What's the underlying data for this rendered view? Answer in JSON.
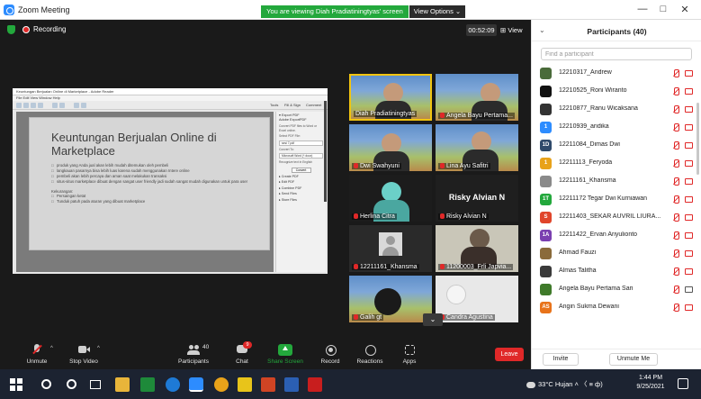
{
  "window": {
    "title": "Zoom Meeting",
    "viewing_banner": "You are viewing Diah Pradiatiningtyas' screen",
    "view_options": "View Options ⌄",
    "minimize": "—",
    "maximize": "□",
    "close": "✕"
  },
  "meeting": {
    "recording_label": "Recording",
    "timer": "00:52:09",
    "view_label": "⊞ View"
  },
  "shared": {
    "viewer_title": "Keuntungan Berjualan Online di Marketplace - Adobe Reader",
    "menu": "File Edit View Window Help",
    "toolbar_right": [
      "Tools",
      "Fill & Sign",
      "Comment"
    ],
    "slide_title": "Keuntungan Berjualan Online di Marketplace",
    "bullets": [
      "produk yang Anda jual akan lebih mudah ditemukan oleh pembeli",
      "langkauan pasarnya bisa lebih luas karena sudah menggunakan Intere online",
      "pembeli akan lebih percaya dan aman saat melakukan transaksi",
      "situs-situs marketplace dibuat dengan sangat user friendly jadi sudah sangat mudah digunakan untuk para user"
    ],
    "sub_heading": "Kekurangan:",
    "sub_bullets": [
      "Persaingan ketat",
      "Tunduk patuh pada aturan yang dibuat marketplace"
    ],
    "side_panel": {
      "head": "▾ Export PDF",
      "title": "Adobe ExportPDF",
      "desc": "Convert PDF files to Word or Excel online.",
      "select_label": "Select PDF File:",
      "file": "sesi 7.pdf",
      "convert_label": "Convert To:",
      "format": "Microsoft Word (*.docx)",
      "ocr_label": "Recognize text in English",
      "convert_button": "Convert",
      "items": [
        "▸ Create PDF",
        "▸ Edit PDF",
        "▸ Combine PDF",
        "▸ Send Files",
        "▸ Store Files"
      ]
    }
  },
  "tiles": [
    {
      "name": "Diah Pradiatiningtyas",
      "type": "video",
      "active": true
    },
    {
      "name": "Angela Bayu Pertama...",
      "type": "video",
      "active": false
    },
    {
      "name": "Dwi Swahyuni",
      "type": "video",
      "active": false
    },
    {
      "name": "Lina Ayu Safitri",
      "type": "video",
      "active": false
    },
    {
      "name": "Herlina Citra",
      "type": "video",
      "active": false
    },
    {
      "name": "Risky Alvian N",
      "type": "name",
      "big": "Risky Alvian N",
      "active": false
    },
    {
      "name": "12211161_Khansma",
      "type": "avatar",
      "active": false
    },
    {
      "name": "11200003_Frli Japvia...",
      "type": "video",
      "active": false
    },
    {
      "name": "Galih gt",
      "type": "video",
      "active": false
    },
    {
      "name": "Candra Agustina",
      "type": "video",
      "active": false
    }
  ],
  "toolbar": {
    "unmute": "Unmute",
    "stop_video": "Stop Video",
    "participants": "Participants",
    "participants_count": "40",
    "chat": "Chat",
    "chat_badge": "9",
    "share_screen": "Share Screen",
    "record": "Record",
    "reactions": "Reactions",
    "apps": "Apps",
    "leave": "Leave"
  },
  "panel": {
    "title": "Participants (40)",
    "search_placeholder": "Find a participant",
    "invite": "Invite",
    "unmute_me": "Unmute Me",
    "participants": [
      {
        "name": "12210317_Andrew",
        "initials": "",
        "color": "#4a6b3a",
        "cam_on": false
      },
      {
        "name": "12210525_Roni Wiranto",
        "initials": "",
        "color": "#111111",
        "cam_on": false
      },
      {
        "name": "12210877_Ranu Wicaksana",
        "initials": "",
        "color": "#333333",
        "cam_on": false
      },
      {
        "name": "12210939_aridika",
        "initials": "1",
        "color": "#2d8cff",
        "cam_on": false
      },
      {
        "name": "12211084_Dimas Dwi",
        "initials": "1D",
        "color": "#2f4a6b",
        "cam_on": false
      },
      {
        "name": "12211113_Feryoda",
        "initials": "1",
        "color": "#e8a21a",
        "cam_on": false
      },
      {
        "name": "12211161_Khansma",
        "initials": "",
        "color": "#8a8a8a",
        "cam_on": false
      },
      {
        "name": "12211172 Tegar Dwi Kurniawan",
        "initials": "1T",
        "color": "#23a83c",
        "cam_on": false
      },
      {
        "name": "12211403_SEKAR AUVRIL LIURA...",
        "initials": "S",
        "color": "#e0452b",
        "cam_on": false
      },
      {
        "name": "12211422_Ervan Ariyulionto",
        "initials": "1A",
        "color": "#7a3fb0",
        "cam_on": false
      },
      {
        "name": "Ahmad Fauzi",
        "initials": "",
        "color": "#8a6a3a",
        "cam_on": false
      },
      {
        "name": "Almas Talitha",
        "initials": "",
        "color": "#3a3a3a",
        "cam_on": false
      },
      {
        "name": "Angela Bayu Pertama Sari",
        "initials": "",
        "color": "#3f7a2a",
        "cam_on": true
      },
      {
        "name": "Angin Sukma Dewani",
        "initials": "AS",
        "color": "#e8731a",
        "cam_on": false
      }
    ]
  },
  "taskbar": {
    "weather": "33°C  Hujan  ˄  〈  ≡  ф)",
    "time": "1:44 PM",
    "date": "9/25/2021"
  }
}
